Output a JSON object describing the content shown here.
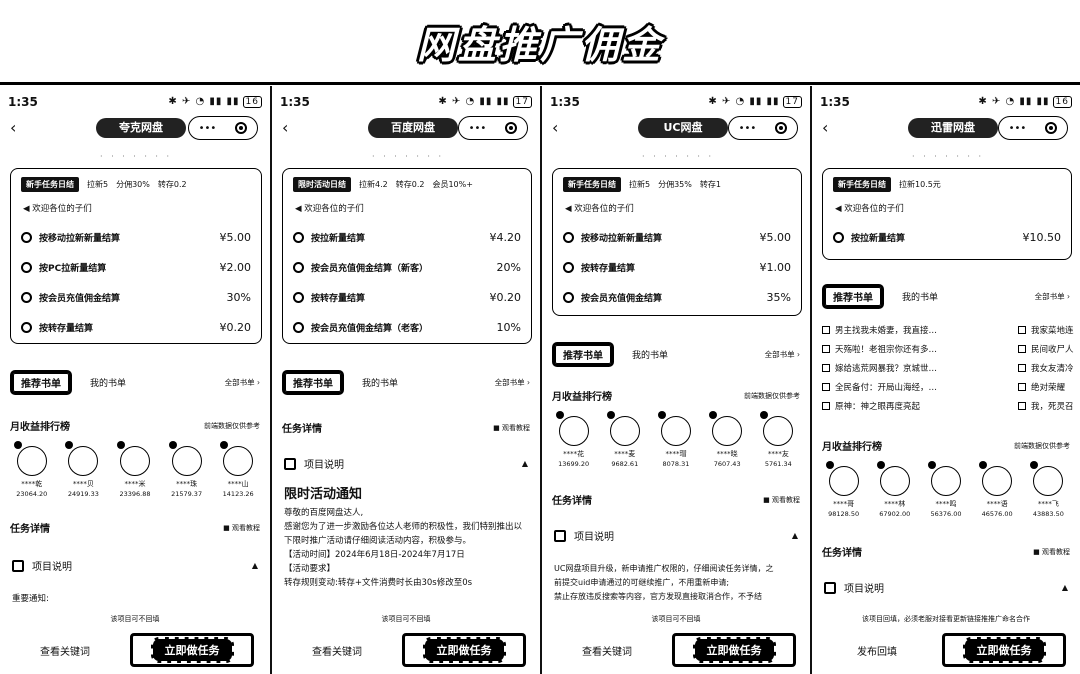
{
  "banner": {
    "title": "网盘推广佣金"
  },
  "phones": [
    {
      "time": "1:35",
      "battery": "16",
      "nav_title": "夸克网盘",
      "caps_label": "•••",
      "tags": [
        "新手任务日结",
        "拉新5",
        "分佣30%",
        "转存0.2"
      ],
      "notice": "欢迎各位的子们",
      "rows": [
        {
          "name": "按移动拉新新量结算",
          "price": "¥5.00"
        },
        {
          "name": "按PC拉新量结算",
          "price": "¥2.00"
        },
        {
          "name": "按会员充值佣金结算",
          "price": "30%"
        },
        {
          "name": "按转存量结算",
          "price": "¥0.20"
        }
      ],
      "tab_active": "推荐书单",
      "tab_books": "我的书单",
      "tab_all": "全部书单 ›",
      "rank_title": "月收益排行榜",
      "rank_sub": "前端数据仅供参考",
      "avatars": [
        {
          "name": "****乾",
          "amt": "23064.20"
        },
        {
          "name": "****贝",
          "amt": "24919.33"
        },
        {
          "name": "****米",
          "amt": "23396.88"
        },
        {
          "name": "****珠",
          "amt": "21579.37"
        },
        {
          "name": "****山",
          "amt": "14123.26"
        }
      ],
      "task_title": "任务详情",
      "task_sub": "观看教程",
      "project": "项目说明",
      "body_lines": [
        "重要通知:"
      ],
      "foot_note": "该项目可不回填",
      "keyword": "查看关键词",
      "go": "立即做任务"
    },
    {
      "time": "1:35",
      "battery": "17",
      "nav_title": "百度网盘",
      "caps_label": "•••",
      "tags": [
        "限时活动日结",
        "拉新4.2",
        "转存0.2",
        "会员10%+"
      ],
      "notice": "欢迎各位的子们",
      "rows": [
        {
          "name": "按拉新量结算",
          "price": "¥4.20"
        },
        {
          "name": "按会员充值佣金结算（新客）",
          "price": "20%"
        },
        {
          "name": "按转存量结算",
          "price": "¥0.20"
        },
        {
          "name": "按会员充值佣金结算（老客）",
          "price": "10%"
        }
      ],
      "tab_active": "推荐书单",
      "tab_books": "我的书单",
      "tab_all": "全部书单 ›",
      "task_title": "任务详情",
      "task_sub": "观看教程",
      "project": "项目说明",
      "headline": "限时活动通知",
      "body_lines": [
        "尊敬的百度网盘达人,",
        "感谢您为了进一步激励各位达人老师的积极性，我们特别推出以",
        "下限时推广活动请仔细阅读活动内容，积极参与。",
        "【活动时间】2024年6月18日-2024年7月17日",
        "【活动要求】",
        "转存规则变动:转存+文件消费时长由30s修改至0s"
      ],
      "foot_note": "该项目可不回填",
      "keyword": "查看关键词",
      "go": "立即做任务"
    },
    {
      "time": "1:35",
      "battery": "17",
      "nav_title": "UC网盘",
      "caps_label": "•••",
      "tags": [
        "新手任务日结",
        "拉新5",
        "分佣35%",
        "转存1"
      ],
      "notice": "欢迎各位的子们",
      "rows": [
        {
          "name": "按移动拉新新量结算",
          "price": "¥5.00"
        },
        {
          "name": "按转存量结算",
          "price": "¥1.00"
        },
        {
          "name": "按会员充值佣金结算",
          "price": "35%"
        }
      ],
      "tab_active": "推荐书单",
      "tab_books": "我的书单",
      "tab_all": "全部书单 ›",
      "rank_title": "月收益排行榜",
      "rank_sub": "前端数据仅供参考",
      "avatars": [
        {
          "name": "****花",
          "amt": "13699.20"
        },
        {
          "name": "****麦",
          "amt": "9682.61"
        },
        {
          "name": "****瑁",
          "amt": "8078.31"
        },
        {
          "name": "****晓",
          "amt": "7607.43"
        },
        {
          "name": "****友",
          "amt": "5761.34"
        }
      ],
      "task_title": "任务详情",
      "task_sub": "观看教程",
      "project": "项目说明",
      "body_lines": [
        "UC网盘项目升级，新申请推广权限的，仔细阅读任务详情，之",
        "前提交uid申请通过的可继续推广，不用重新申请;",
        "禁止存放违反搜索等内容，官方发现直接取消合作，不予结"
      ],
      "foot_note": "该项目可不回填",
      "keyword": "查看关键词",
      "go": "立即做任务"
    },
    {
      "time": "1:35",
      "battery": "16",
      "nav_title": "迅雷网盘",
      "caps_label": "•••",
      "tags": [
        "新手任务日结",
        "拉新10.5元"
      ],
      "notice": "欢迎各位的子们",
      "rows": [
        {
          "name": "按拉新量结算",
          "price": "¥10.50"
        }
      ],
      "tab_active": "推荐书单",
      "tab_books": "我的书单",
      "tab_all": "全部书单 ›",
      "books_left": [
        "男主找我未婚妻，我直接…",
        "天殇啦！老祖宗你还有多…",
        "嫁给逃荒网暴我？京城世…",
        "全民备付：开局山海经，…",
        "原神：神之眼再度亮起"
      ],
      "books_right": [
        "我家菜地连",
        "民间收尸人",
        "我女友清冷",
        "绝对荣耀",
        "我，死灵召"
      ],
      "rank_title": "月收益排行榜",
      "rank_sub": "前端数据仅供参考",
      "avatars": [
        {
          "name": "****哥",
          "amt": "98128.50"
        },
        {
          "name": "****林",
          "amt": "67902.00"
        },
        {
          "name": "****鸣",
          "amt": "56376.00"
        },
        {
          "name": "****语",
          "amt": "46576.00"
        },
        {
          "name": "****飞",
          "amt": "43883.50"
        }
      ],
      "task_title": "任务详情",
      "task_sub": "观看教程",
      "project": "项目说明",
      "foot_note": "该项目回填，必须老服对接看更新链接推推广命名合作",
      "keyword": "发布回填",
      "go": "立即做任务"
    }
  ]
}
